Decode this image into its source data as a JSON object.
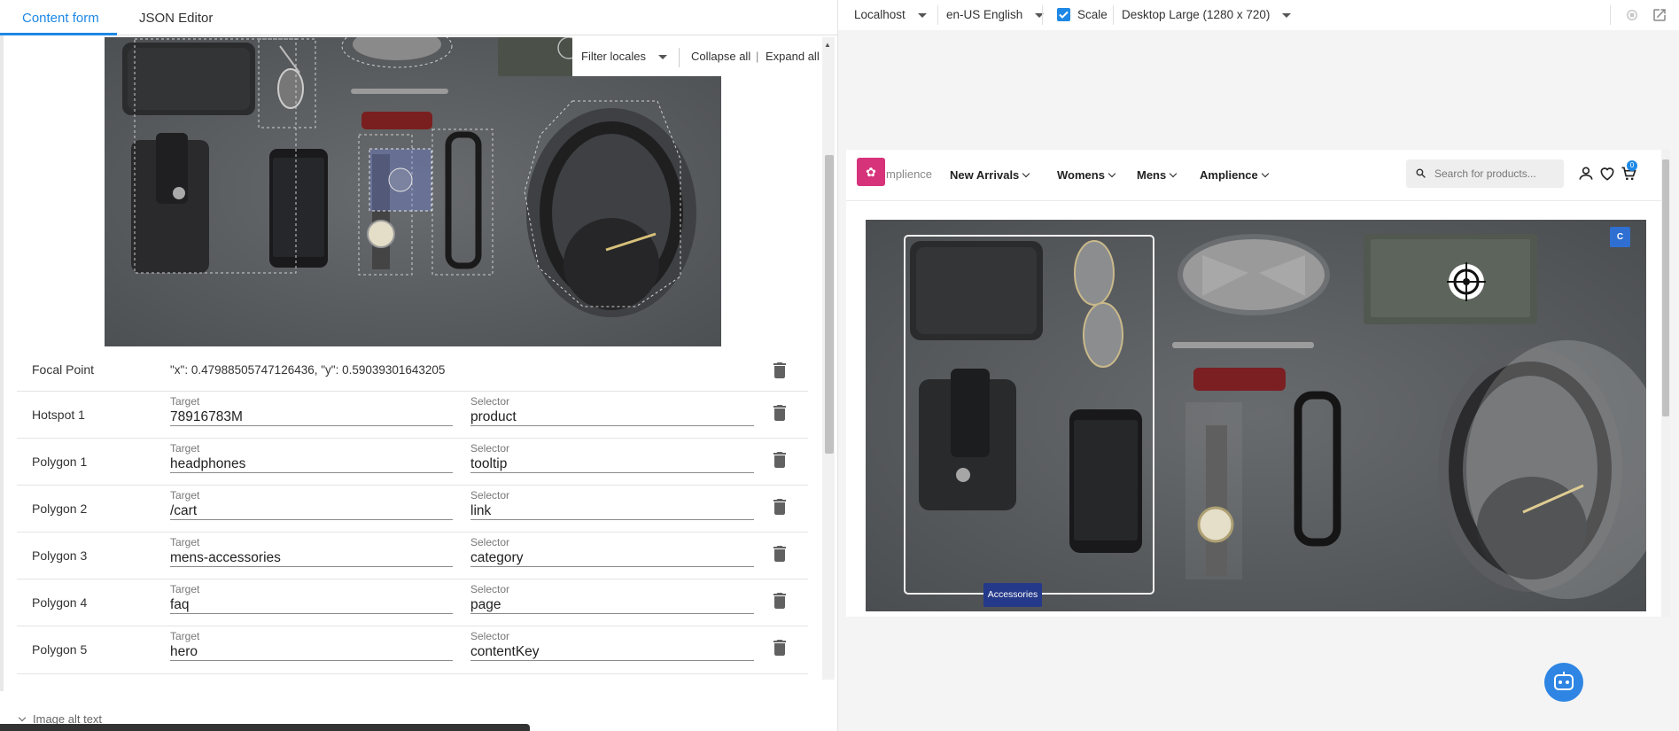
{
  "tabs": [
    {
      "label": "Content form",
      "active": true
    },
    {
      "label": "JSON Editor",
      "active": false
    }
  ],
  "image_toolbar": {
    "filter_locales": "Filter locales",
    "collapse_all": "Collapse all",
    "separator": "|",
    "expand_all": "Expand all"
  },
  "focal_point": {
    "label": "Focal Point",
    "value": "\"x\": 0.47988505747126436, \"y\": 0.59039301643205"
  },
  "rows": [
    {
      "label": "Hotspot 1",
      "target_label": "Target",
      "target": "78916783M",
      "selector_label": "Selector",
      "selector": "product"
    },
    {
      "label": "Polygon 1",
      "target_label": "Target",
      "target": "headphones",
      "selector_label": "Selector",
      "selector": "tooltip"
    },
    {
      "label": "Polygon 2",
      "target_label": "Target",
      "target": "/cart",
      "selector_label": "Selector",
      "selector": "link"
    },
    {
      "label": "Polygon 3",
      "target_label": "Target",
      "target": "mens-accessories",
      "selector_label": "Selector",
      "selector": "category"
    },
    {
      "label": "Polygon 4",
      "target_label": "Target",
      "target": "faq",
      "selector_label": "Selector",
      "selector": "page"
    },
    {
      "label": "Polygon 5",
      "target_label": "Target",
      "target": "hero",
      "selector_label": "Selector",
      "selector": "contentKey"
    }
  ],
  "alt_text_label": "Image alt text",
  "preview_toolbar": {
    "environment": "Localhost",
    "locale": "en-US English",
    "scale_label": "Scale",
    "scale_checked": true,
    "device": "Desktop Large (1280 x 720)"
  },
  "site": {
    "logo_text": "mplience",
    "nav": [
      "New Arrivals",
      "Womens",
      "Mens",
      "Amplience"
    ],
    "search_placeholder": "Search for products...",
    "cart_count": "0",
    "hero_tag": "Accessories",
    "hero_badge": "C"
  },
  "colors": {
    "accent": "#1e88e5",
    "brand": "#d6337b",
    "tag": "#25398a"
  }
}
